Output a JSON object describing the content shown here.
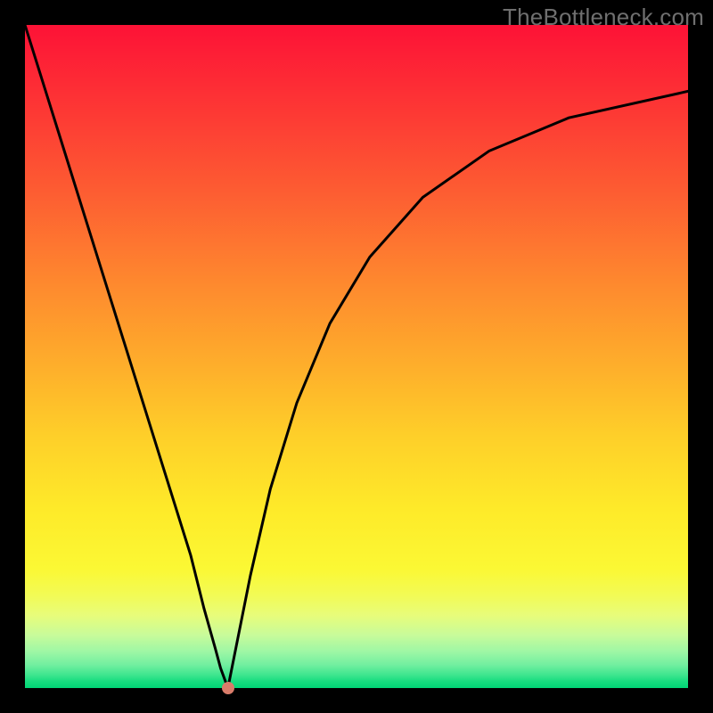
{
  "watermark": "TheBottleneck.com",
  "colors": {
    "frame": "#000000",
    "watermark": "#6f6f6f",
    "curve": "#000000",
    "dot": "#d97c6a",
    "gradient_stops": [
      "#fd1236",
      "#fd2f35",
      "#fd5c32",
      "#fe8c2e",
      "#feb02b",
      "#fecf29",
      "#feea29",
      "#fbf834",
      "#f2fb55",
      "#e8fc7a",
      "#c8fb9a",
      "#9ef7a5",
      "#72efa0",
      "#3fe68f",
      "#17dd7f",
      "#00d576"
    ]
  },
  "chart_data": {
    "type": "line",
    "title": "",
    "xlabel": "",
    "ylabel": "",
    "xlim": [
      0,
      100
    ],
    "ylim": [
      0,
      100
    ],
    "note": "axes unlabeled; values are percentages of plot width/height, y=0 is bottom",
    "series": [
      {
        "name": "left-branch",
        "x": [
          0,
          5,
          10,
          15,
          20,
          25,
          27,
          28.7,
          29.5,
          30.6
        ],
        "y": [
          100,
          84,
          68,
          52,
          36,
          20,
          12,
          6,
          3,
          0
        ]
      },
      {
        "name": "right-branch",
        "x": [
          30.6,
          32,
          34,
          37,
          41,
          46,
          52,
          60,
          70,
          82,
          100
        ],
        "y": [
          0,
          7,
          17,
          30,
          43,
          55,
          65,
          74,
          81,
          86,
          90
        ]
      }
    ],
    "marker": {
      "x": 30.6,
      "y": 0
    },
    "legend": false,
    "grid": false
  }
}
